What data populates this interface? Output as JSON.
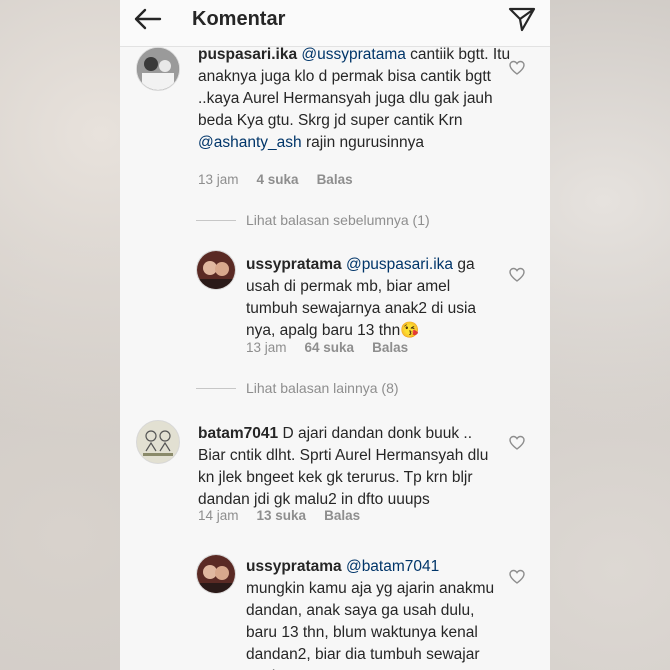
{
  "header": {
    "title": "Komentar",
    "back_icon": "arrow-left-icon",
    "send_icon": "paper-plane-icon"
  },
  "comments": [
    {
      "username": "puspasari.ika",
      "mention": "@ussypratama",
      "text_part1": " cantiik bgtt. Itu anaknya juga klo d permak bisa cantik bgtt ..kaya Aurel Hermansyah juga dlu gak jauh beda Kya gtu. Skrg jd super cantik Krn ",
      "mention2": "@ashanty_ash",
      "text_part2": " rajin ngurusinnya",
      "time": "13 jam",
      "likes": "4 suka",
      "reply": "Balas"
    },
    {
      "thread_label": "Lihat balasan sebelumnya (1)"
    },
    {
      "username": "ussypratama",
      "mention": "@puspasari.ika",
      "text_part1": " ga usah di permak mb, biar amel tumbuh sewajarnya anak2 di usia nya, apalg baru 13 thn😘",
      "time": "13 jam",
      "likes": "64 suka",
      "reply": "Balas"
    },
    {
      "thread_label": "Lihat balasan lainnya (8)"
    },
    {
      "username": "batam7041",
      "text_part1": " D ajari dandan donk buuk .. Biar cntik dlht. Sprti Aurel Hermansyah dlu kn jlek bngeet kek gk terurus. Tp krn bljr dandan jdi gk malu2 in dfto uuups",
      "time": "14 jam",
      "likes": "13 suka",
      "reply": "Balas"
    },
    {
      "username": "ussypratama",
      "mention": "@batam7041",
      "text_part1": " mungkin kamu aja yg ajarin anakmu dandan, anak saya ga usah dulu, baru 13 thn, blum waktunya kenal dandan2, biar dia tumbuh sewajar anak seumurnya"
    }
  ],
  "colors": {
    "mention": "#003569",
    "meta": "#8e8e8e",
    "text": "#262626"
  }
}
